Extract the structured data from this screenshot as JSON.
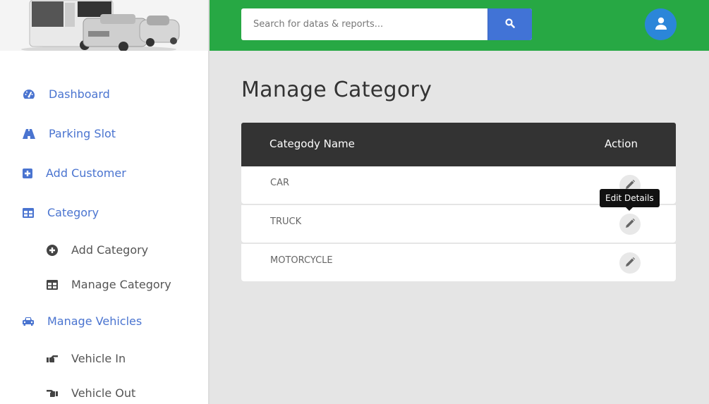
{
  "sidebar": {
    "logo_alt": "vehicles-logo",
    "items": [
      {
        "label": "Dashboard",
        "icon": "dashboard-icon"
      },
      {
        "label": "Parking Slot",
        "icon": "road-icon"
      },
      {
        "label": "Add Customer",
        "icon": "plus-square-icon"
      },
      {
        "label": "Category",
        "icon": "table-icon"
      },
      {
        "label": "Add Category",
        "icon": "plus-circle-icon"
      },
      {
        "label": "Manage Category",
        "icon": "table-icon"
      },
      {
        "label": "Manage Vehicles",
        "icon": "car-icon"
      },
      {
        "label": "Vehicle In",
        "icon": "hand-point-right-icon"
      },
      {
        "label": "Vehicle Out",
        "icon": "hand-point-left-icon"
      }
    ]
  },
  "header": {
    "search": {
      "placeholder": "Search for datas & reports...",
      "value": ""
    },
    "search_button_icon": "search-icon",
    "user_icon": "user-icon"
  },
  "main": {
    "title": "Manage Category",
    "table": {
      "columns": [
        "Categody Name",
        "Action"
      ],
      "rows": [
        {
          "name": "CAR"
        },
        {
          "name": "TRUCK"
        },
        {
          "name": "MOTORCYCLE"
        }
      ]
    },
    "tooltip": "Edit Details"
  },
  "colors": {
    "header_green": "#27a844",
    "accent_blue": "#4a74d0",
    "search_button": "#4173d6",
    "avatar_blue": "#2b86d9",
    "table_header": "#333333"
  }
}
